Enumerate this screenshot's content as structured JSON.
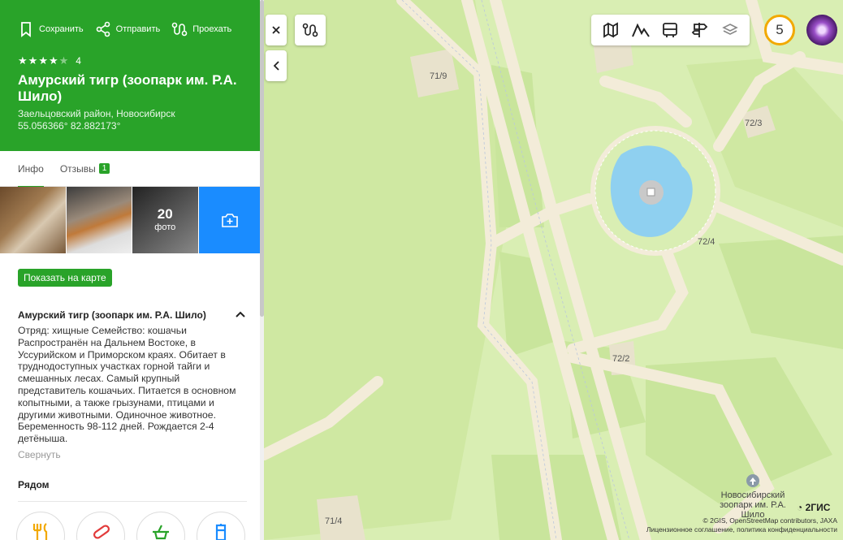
{
  "actions": {
    "save": "Сохранить",
    "share": "Отправить",
    "route": "Проехать"
  },
  "rating": {
    "value": "4",
    "stars": 4,
    "max": 5
  },
  "place": {
    "title": "Амурский тигр (зоопарк им. Р.А. Шило)",
    "district": "Заельцовский район, Новосибирск",
    "coords": "55.056366° 82.882173°"
  },
  "tabs": {
    "info": "Инфо",
    "reviews": "Отзывы",
    "reviews_count": "1"
  },
  "photos": {
    "count": "20",
    "label": "фото"
  },
  "show_on_map": "Показать на карте",
  "description": {
    "title": "Амурский тигр (зоопарк им. Р.А. Шило)",
    "text": "Отряд: хищные Семейство: кошачьи Распространён на Дальнем Востоке, в Уссурийском и Приморском краях. Обитает в труднодоступных участках горной тайги и смешанных лесах. Самый крупный представитель кошачьих. Питается в основном копытными, а также грызунами, птицами и другими животными. Одиночное животное. Беременность 98-112 дней. Рождается 2-4 детёныша.",
    "collapse": "Свернуть"
  },
  "nearby": {
    "title": "Рядом"
  },
  "map": {
    "notifications": "5",
    "labels": {
      "l71_9": "71/9",
      "l72_3": "72/3",
      "l72_4": "72/4",
      "l72_2": "72/2",
      "l71_4": "71/4"
    },
    "poi": {
      "zoo": "Новосибирский зоопарк им. Р.А. Шило"
    },
    "logo": "2ГИС",
    "copyright_line1": "© 2GIS, OpenStreetMap contributors, JAXA",
    "copyright_line2": "Лицензионное соглашение, политика конфиденциальности"
  },
  "colors": {
    "accent": "#29a329",
    "map_bg": "#d9eeb3",
    "map_road": "#f3ecd9",
    "water": "#8fd0f0",
    "photo_add": "#1a8cff"
  }
}
